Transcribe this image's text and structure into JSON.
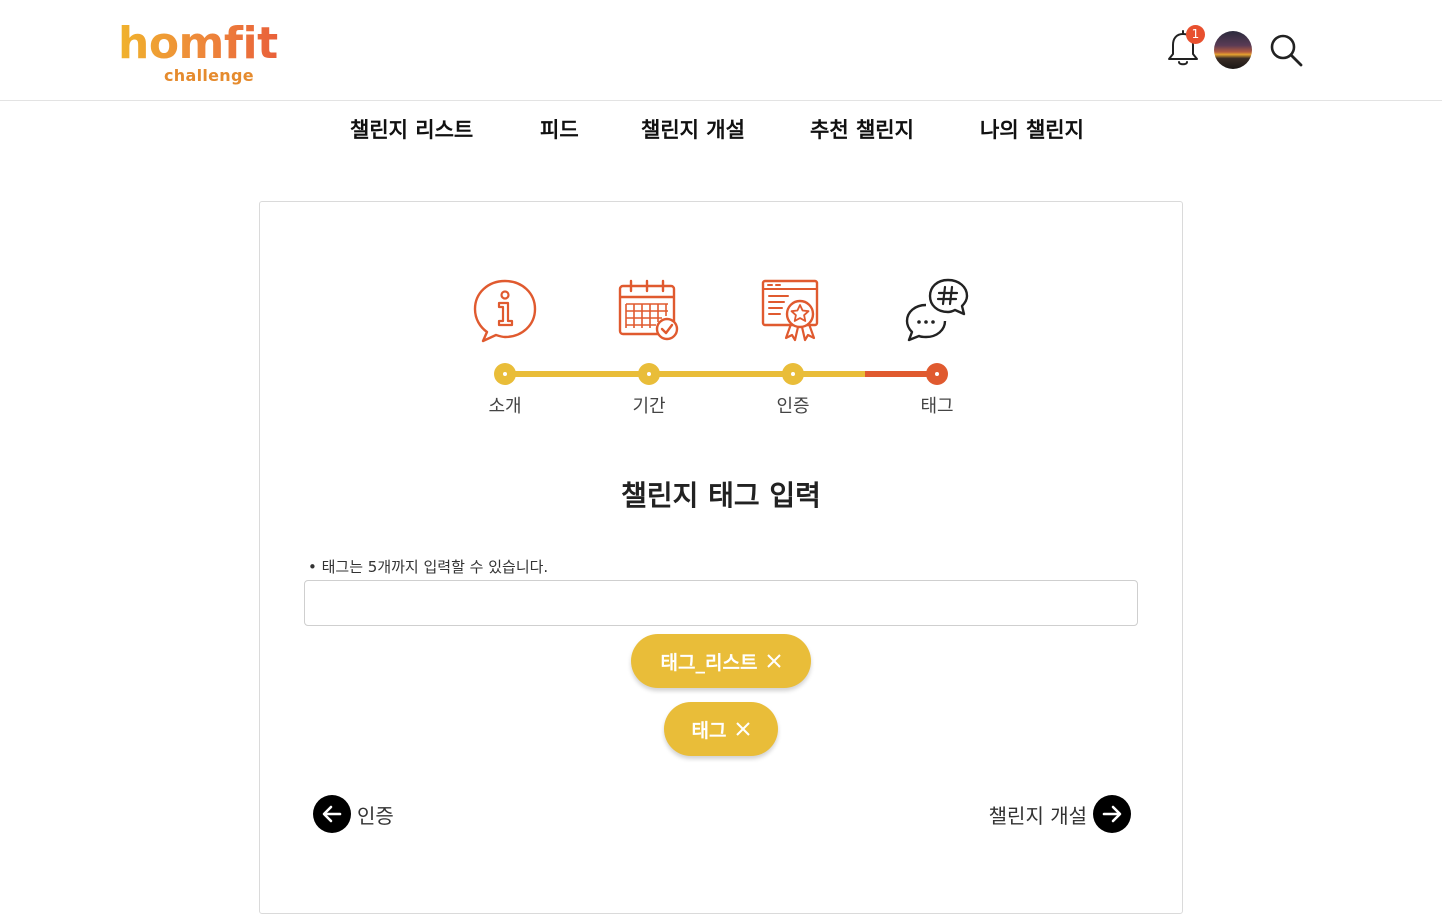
{
  "brand": {
    "name": "homfit",
    "tagline": "challenge"
  },
  "header": {
    "notification_count": "1"
  },
  "nav": {
    "items": [
      {
        "label": "챌린지 리스트"
      },
      {
        "label": "피드"
      },
      {
        "label": "챌린지 개설"
      },
      {
        "label": "추천 챌린지"
      },
      {
        "label": "나의 챌린지"
      }
    ]
  },
  "steps": {
    "items": [
      {
        "label": "소개",
        "icon": "info-bubble-icon",
        "state": "done"
      },
      {
        "label": "기간",
        "icon": "calendar-check-icon",
        "state": "done"
      },
      {
        "label": "인증",
        "icon": "certificate-award-icon",
        "state": "done"
      },
      {
        "label": "태그",
        "icon": "hashtag-chat-icon",
        "state": "current"
      }
    ]
  },
  "form": {
    "title": "챌린지 태그 입력",
    "hint": "• 태그는 5개까지 입력할 수 있습니다.",
    "input_value": "",
    "input_placeholder": "",
    "tags": [
      {
        "label": "태그_리스트"
      },
      {
        "label": "태그"
      }
    ]
  },
  "footer_nav": {
    "prev_label": "인증",
    "next_label": "챌린지 개설"
  },
  "colors": {
    "accent_yellow": "#e9bd39",
    "accent_orange": "#e05a2f",
    "badge": "#e8502e"
  }
}
